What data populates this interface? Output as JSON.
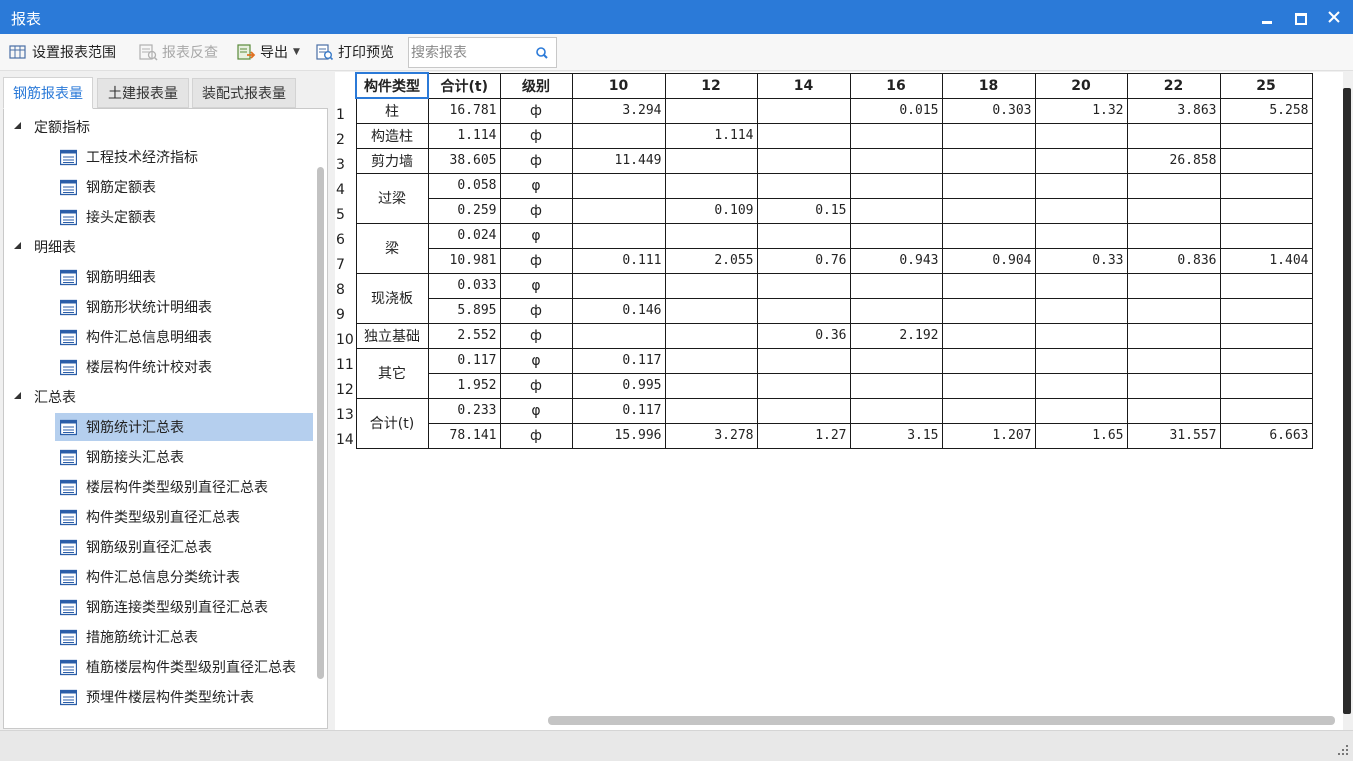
{
  "window": {
    "title": "报表",
    "accent": "#2b7ad8"
  },
  "toolbar": {
    "set_range": "设置报表范围",
    "review": "报表反查",
    "export": "导出",
    "print_preview": "打印预览",
    "search_placeholder": "搜索报表"
  },
  "tabs": [
    "钢筋报表量",
    "土建报表量",
    "装配式报表量"
  ],
  "tree": [
    {
      "group": "定额指标",
      "items": [
        "工程技术经济指标",
        "钢筋定额表",
        "接头定额表"
      ]
    },
    {
      "group": "明细表",
      "items": [
        "钢筋明细表",
        "钢筋形状统计明细表",
        "构件汇总信息明细表",
        "楼层构件统计校对表"
      ]
    },
    {
      "group": "汇总表",
      "items": [
        "钢筋统计汇总表",
        "钢筋接头汇总表",
        "楼层构件类型级别直径汇总表",
        "构件类型级别直径汇总表",
        "钢筋级别直径汇总表",
        "构件汇总信息分类统计表",
        "钢筋连接类型级别直径汇总表",
        "措施筋统计汇总表",
        "植筋楼层构件类型级别直径汇总表",
        "预埋件楼层构件类型统计表"
      ]
    }
  ],
  "selected_item": "钢筋统计汇总表",
  "grid": {
    "headers": [
      "构件类型",
      "合计(t)",
      "级别",
      "10",
      "12",
      "14",
      "16",
      "18",
      "20",
      "22",
      "25"
    ],
    "rows": [
      {
        "n": "1",
        "type": "柱",
        "span": 1,
        "total": "16.781",
        "grade": "ф",
        "v": [
          "3.294",
          "",
          "",
          "0.015",
          "0.303",
          "1.32",
          "3.863",
          "5.258"
        ]
      },
      {
        "n": "2",
        "type": "构造柱",
        "span": 1,
        "total": "1.114",
        "grade": "ф",
        "v": [
          "",
          "1.114",
          "",
          "",
          "",
          "",
          "",
          ""
        ]
      },
      {
        "n": "3",
        "type": "剪力墙",
        "span": 1,
        "total": "38.605",
        "grade": "ф",
        "v": [
          "11.449",
          "",
          "",
          "",
          "",
          "",
          "26.858",
          ""
        ]
      },
      {
        "n": "4",
        "type": "过梁",
        "span": 2,
        "total": "0.058",
        "grade": "φ",
        "v": [
          "",
          "",
          "",
          "",
          "",
          "",
          "",
          ""
        ]
      },
      {
        "n": "5",
        "type": "",
        "span": 0,
        "total": "0.259",
        "grade": "ф",
        "v": [
          "",
          "0.109",
          "0.15",
          "",
          "",
          "",
          "",
          ""
        ]
      },
      {
        "n": "6",
        "type": "梁",
        "span": 2,
        "total": "0.024",
        "grade": "φ",
        "v": [
          "",
          "",
          "",
          "",
          "",
          "",
          "",
          ""
        ]
      },
      {
        "n": "7",
        "type": "",
        "span": 0,
        "total": "10.981",
        "grade": "ф",
        "v": [
          "0.111",
          "2.055",
          "0.76",
          "0.943",
          "0.904",
          "0.33",
          "0.836",
          "1.404"
        ]
      },
      {
        "n": "8",
        "type": "现浇板",
        "span": 2,
        "total": "0.033",
        "grade": "φ",
        "v": [
          "",
          "",
          "",
          "",
          "",
          "",
          "",
          ""
        ]
      },
      {
        "n": "9",
        "type": "",
        "span": 0,
        "total": "5.895",
        "grade": "ф",
        "v": [
          "0.146",
          "",
          "",
          "",
          "",
          "",
          "",
          ""
        ]
      },
      {
        "n": "10",
        "type": "独立基础",
        "span": 1,
        "total": "2.552",
        "grade": "ф",
        "v": [
          "",
          "",
          "0.36",
          "2.192",
          "",
          "",
          "",
          ""
        ]
      },
      {
        "n": "11",
        "type": "其它",
        "span": 2,
        "total": "0.117",
        "grade": "φ",
        "v": [
          "0.117",
          "",
          "",
          "",
          "",
          "",
          "",
          ""
        ]
      },
      {
        "n": "12",
        "type": "",
        "span": 0,
        "total": "1.952",
        "grade": "ф",
        "v": [
          "0.995",
          "",
          "",
          "",
          "",
          "",
          "",
          ""
        ]
      },
      {
        "n": "13",
        "type": "合计(t)",
        "span": 2,
        "total": "0.233",
        "grade": "φ",
        "v": [
          "0.117",
          "",
          "",
          "",
          "",
          "",
          "",
          ""
        ]
      },
      {
        "n": "14",
        "type": "",
        "span": 0,
        "total": "78.141",
        "grade": "ф",
        "v": [
          "15.996",
          "3.278",
          "1.27",
          "3.15",
          "1.207",
          "1.65",
          "31.557",
          "6.663"
        ]
      }
    ]
  }
}
